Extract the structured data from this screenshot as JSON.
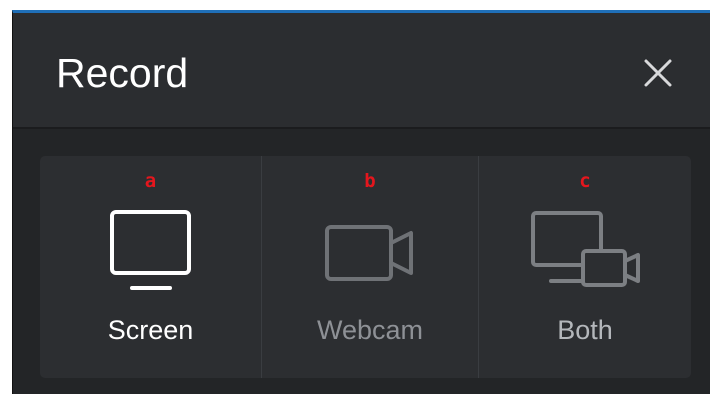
{
  "dialog": {
    "title": "Record"
  },
  "options": [
    {
      "marker": "a",
      "label": "Screen",
      "icon": "monitor-icon"
    },
    {
      "marker": "b",
      "label": "Webcam",
      "icon": "webcam-icon"
    },
    {
      "marker": "c",
      "label": "Both",
      "icon": "screen-and-webcam-icon"
    }
  ],
  "colors": {
    "accent_border": "#1f6fb8",
    "marker": "#e4161d",
    "background": "#232527",
    "panel": "#2c2e31",
    "active_text": "#ffffff",
    "inactive_icon": "#6f7276"
  }
}
